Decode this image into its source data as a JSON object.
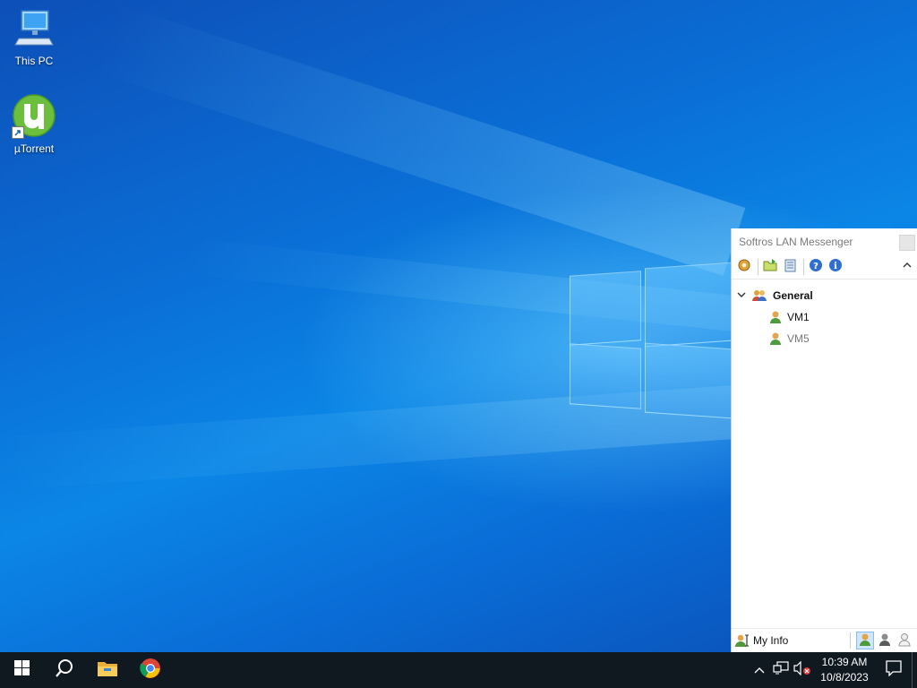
{
  "desktop": {
    "icons": [
      {
        "label": "This PC"
      },
      {
        "label": "µTorrent"
      }
    ]
  },
  "messenger": {
    "title": "Softros LAN Messenger",
    "toolbar": [
      "settings-icon",
      "open-folder-icon",
      "message-log-icon",
      "help-icon",
      "info-icon"
    ],
    "group": {
      "name": "General"
    },
    "contacts": [
      {
        "name": "VM1",
        "status": "online"
      },
      {
        "name": "VM5",
        "status": "away"
      }
    ],
    "status_bar": {
      "my_info_label": "My Info"
    },
    "colors": {
      "online": "#d98c2b",
      "accent": "#2f7fd1"
    }
  },
  "taskbar": {
    "apps": [
      "start",
      "search",
      "file-explorer",
      "chrome"
    ],
    "clock": {
      "time": "10:39 AM",
      "date": "10/8/2023"
    }
  }
}
